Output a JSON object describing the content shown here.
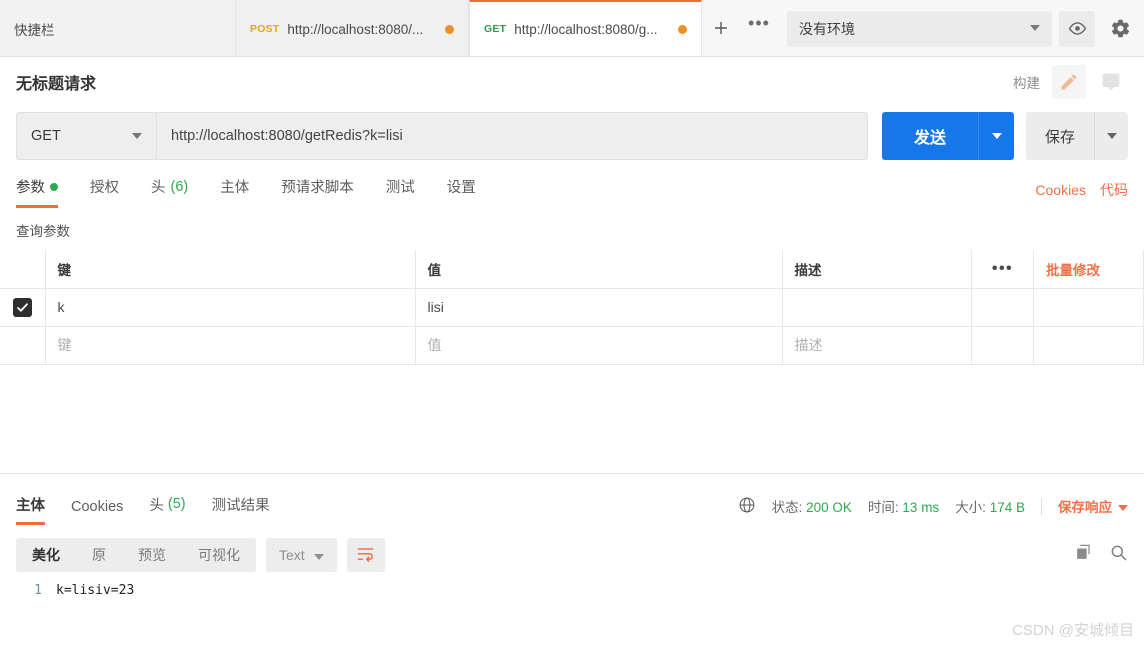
{
  "tabbar": {
    "shortcut_label": "快捷栏",
    "tabs": [
      {
        "method": "POST",
        "url": "http://localhost:8080/...",
        "active": false
      },
      {
        "method": "GET",
        "url": "http://localhost:8080/g...",
        "active": true
      }
    ],
    "new_tab_label": "+",
    "more_label": "•••",
    "environment": "没有环境",
    "eye_icon": "eye-icon",
    "gear_icon": "gear-icon"
  },
  "request": {
    "title": "无标题请求",
    "build_label": "构建",
    "edit_icon": "pencil-icon",
    "comment_icon": "comment-icon",
    "method": "GET",
    "url": "http://localhost:8080/getRedis?k=lisi",
    "send_label": "发送",
    "save_label": "保存",
    "tabs": [
      {
        "label": "参数",
        "badge": "",
        "dot": true,
        "active": true
      },
      {
        "label": "授权",
        "badge": "",
        "dot": false,
        "active": false
      },
      {
        "label": "头",
        "badge": "(6)",
        "dot": false,
        "active": false
      },
      {
        "label": "主体",
        "badge": "",
        "dot": false,
        "active": false
      },
      {
        "label": "预请求脚本",
        "badge": "",
        "dot": false,
        "active": false
      },
      {
        "label": "测试",
        "badge": "",
        "dot": false,
        "active": false
      },
      {
        "label": "设置",
        "badge": "",
        "dot": false,
        "active": false
      }
    ],
    "cookies_link": "Cookies",
    "code_link": "代码"
  },
  "query_params": {
    "section_label": "查询参数",
    "headers": {
      "key": "键",
      "value": "值",
      "description": "描述",
      "bulk_edit": "批量修改",
      "more": "•••"
    },
    "rows": [
      {
        "checked": true,
        "key": "k",
        "value": "lisi",
        "description": "",
        "placeholder": false
      },
      {
        "checked": false,
        "key": "键",
        "value": "值",
        "description": "描述",
        "placeholder": true
      }
    ]
  },
  "response": {
    "tabs": [
      {
        "label": "主体",
        "badge": "",
        "active": true
      },
      {
        "label": "Cookies",
        "badge": "",
        "active": false
      },
      {
        "label": "头",
        "badge": "(5)",
        "active": false
      },
      {
        "label": "测试结果",
        "badge": "",
        "active": false
      }
    ],
    "globe_icon": "globe-icon",
    "status_label": "状态:",
    "status_value": "200 OK",
    "time_label": "时间:",
    "time_value": "13 ms",
    "size_label": "大小:",
    "size_value": "174 B",
    "save_response_label": "保存响应",
    "view_buttons": [
      {
        "label": "美化",
        "active": true
      },
      {
        "label": "原",
        "active": false
      },
      {
        "label": "预览",
        "active": false
      },
      {
        "label": "可视化",
        "active": false
      }
    ],
    "format_value": "Text",
    "wrap_icon": "wrap-text-icon",
    "copy_icon": "copy-icon",
    "search_icon": "search-icon",
    "body_lines": [
      {
        "no": "1",
        "text": "k=lisiv=23"
      }
    ]
  },
  "watermark": "CSDN @安城倾目",
  "colors": {
    "accent_orange": "#f26b3a",
    "link_orange": "#f2704a",
    "send_blue": "#1877e8",
    "success_green": "#2fa84f",
    "method_get": "#2a9d4a",
    "method_post": "#e8a317"
  }
}
